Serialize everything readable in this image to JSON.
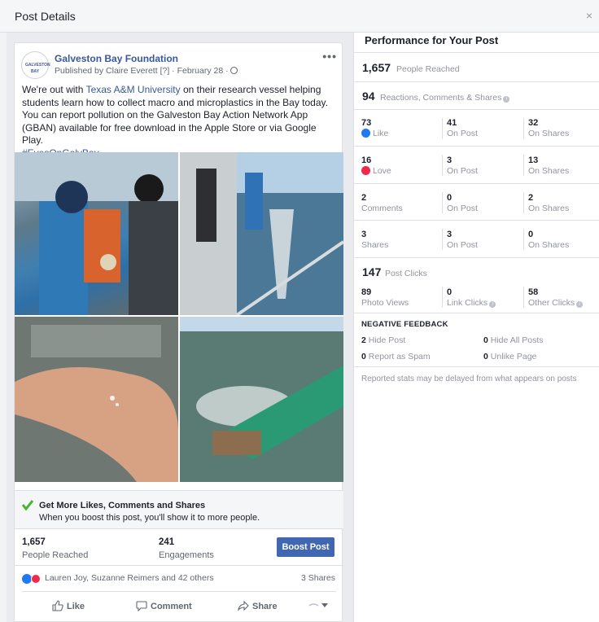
{
  "dialog": {
    "title": "Post Details",
    "close": "×"
  },
  "post": {
    "page_name": "Galveston Bay Foundation",
    "logo_text": "GALVESTON BAY",
    "byline": "Published by Claire Everett [?] · February 28 ·",
    "menu": "•••",
    "text_before_link": "We're out with ",
    "link_text": "Texas A&M University",
    "text_after_link": " on their research vessel helping students learn how to collect macro and microplastics in the Bay today. You can report pollution on the Galveston Bay Action Network App (GBAN) available for free download in the Apple Store or via Google Play.",
    "hashtag": "#EyesOnGalvBay"
  },
  "promo": {
    "title": "Get More Likes, Comments and Shares",
    "subtitle": "When you boost this post, you'll show it to more people."
  },
  "summary": {
    "reached_value": "1,657",
    "reached_label": "People Reached",
    "engagements_value": "241",
    "engagements_label": "Engagements",
    "boost_label": "Boost Post"
  },
  "reactions": {
    "names": "Lauren Joy, Suzanne Reimers and 42 others",
    "shares": "3 Shares"
  },
  "actions": {
    "like": "Like",
    "comment": "Comment",
    "share": "Share"
  },
  "performance": {
    "title": "Performance for Your Post",
    "reached_value": "1,657",
    "reached_label": "People Reached",
    "reactions_value": "94",
    "reactions_label": "Reactions, Comments & Shares",
    "grid": [
      {
        "total": "73",
        "label": "Like",
        "on_post": "41",
        "on_shares": "32"
      },
      {
        "total": "16",
        "label": "Love",
        "on_post": "3",
        "on_shares": "13"
      },
      {
        "total": "2",
        "label": "Comments",
        "on_post": "0",
        "on_shares": "2"
      },
      {
        "total": "3",
        "label": "Shares",
        "on_post": "3",
        "on_shares": "0"
      }
    ],
    "on_post_label": "On Post",
    "on_shares_label": "On Shares",
    "clicks_value": "147",
    "clicks_label": "Post Clicks",
    "photo_views_value": "89",
    "photo_views_label": "Photo Views",
    "link_clicks_value": "0",
    "link_clicks_label": "Link Clicks",
    "other_clicks_value": "58",
    "other_clicks_label": "Other Clicks",
    "negative_title": "NEGATIVE FEEDBACK",
    "hide_post_value": "2",
    "hide_post_label": "Hide Post",
    "hide_all_value": "0",
    "hide_all_label": "Hide All Posts",
    "spam_value": "0",
    "spam_label": "Report as Spam",
    "unlike_value": "0",
    "unlike_label": "Unlike Page",
    "footnote": "Reported stats may be delayed from what appears on posts"
  },
  "colors": {
    "brand_blue": "#4267b2",
    "link_blue": "#385898",
    "like_blue": "#2078f4",
    "love_red": "#f0284a",
    "check_green": "#42b72a"
  }
}
